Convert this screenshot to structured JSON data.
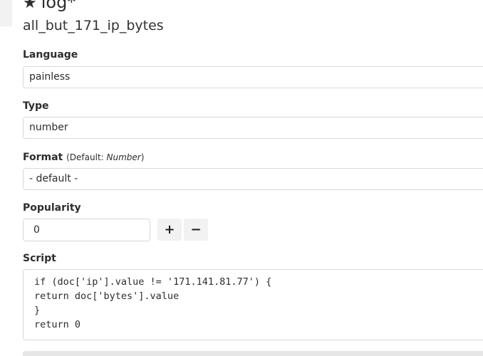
{
  "header": {
    "title": "log*",
    "star_glyph": "★",
    "star_icon": "star-icon"
  },
  "field": {
    "name": "all_but_171_ip_bytes"
  },
  "language": {
    "label": "Language",
    "value": "painless"
  },
  "type": {
    "label": "Type",
    "value": "number"
  },
  "format": {
    "label": "Format",
    "hint_prefix": "(Default: ",
    "hint_value": "Number",
    "hint_suffix": ")",
    "value": "- default -"
  },
  "popularity": {
    "label": "Popularity",
    "value": "0",
    "increment_label": "+",
    "decrement_label": "−"
  },
  "script": {
    "label": "Script",
    "lines": [
      "if (doc['ip'].value != '171.141.81.77') {",
      "return doc['bytes'].value",
      "}",
      "return 0"
    ]
  }
}
